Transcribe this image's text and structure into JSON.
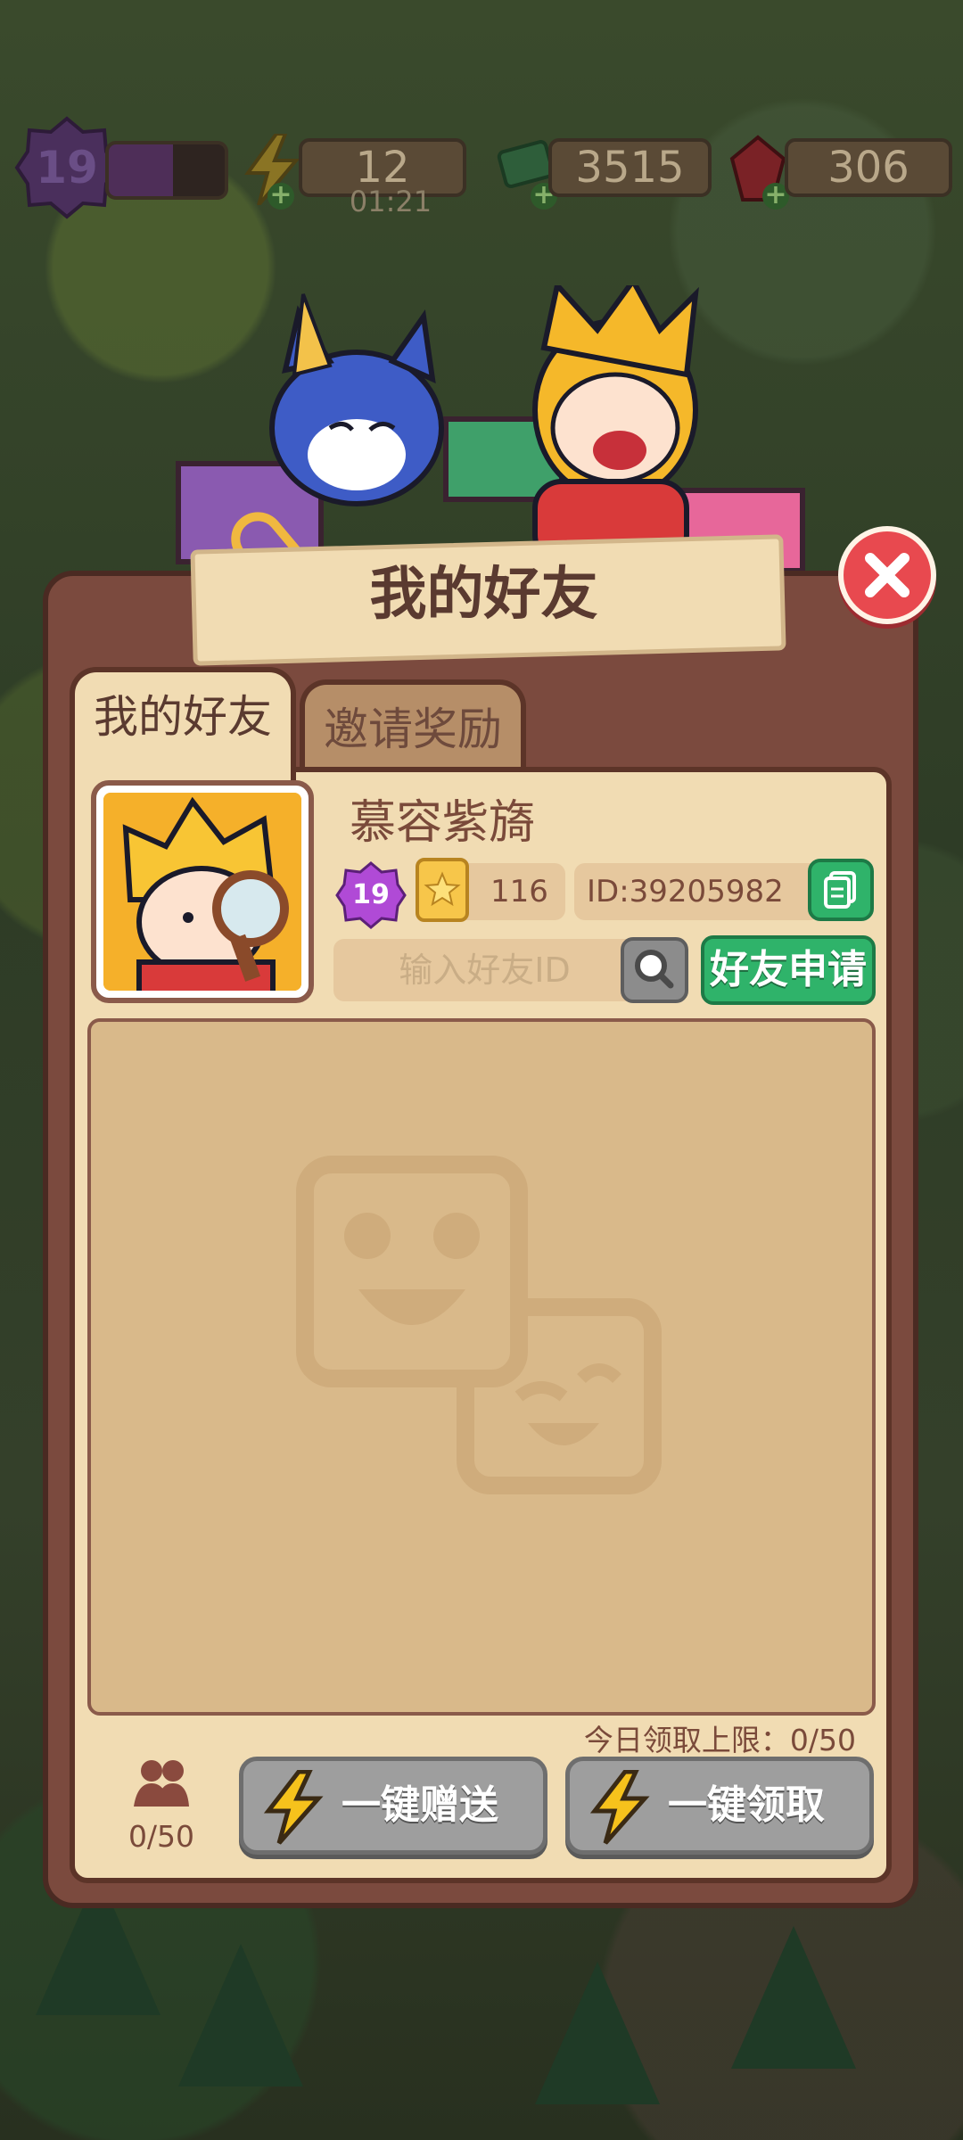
{
  "hud": {
    "level": "19",
    "level_progress": 0.55,
    "energy": "12",
    "energy_timer": "01:21",
    "cash": "3515",
    "gems": "306"
  },
  "dialog": {
    "title": "我的好友",
    "tabs": [
      {
        "label": "我的好友",
        "active": true
      },
      {
        "label": "邀请奖励",
        "active": false
      }
    ],
    "player": {
      "name": "慕容紫旖",
      "level": "19",
      "points": "116",
      "id": "ID:39205982"
    },
    "search": {
      "placeholder": "输入好友ID"
    },
    "friend_request_label": "好友申请",
    "daily_limit": "今日领取上限：0/50",
    "friend_count": "0/50",
    "send_all_label": "一键赠送",
    "claim_all_label": "一键领取"
  },
  "colors": {
    "accent_green": "#2fb36a",
    "close_red": "#e8494f",
    "panel_bg": "#f1dcb3",
    "frame_brown": "#7b4a3e"
  },
  "icons": [
    "close-icon",
    "copy-icon",
    "search-icon",
    "friends-icon",
    "lightning-icon",
    "level-gem-icon",
    "ticket-star-icon",
    "empty-smiley-icon"
  ]
}
